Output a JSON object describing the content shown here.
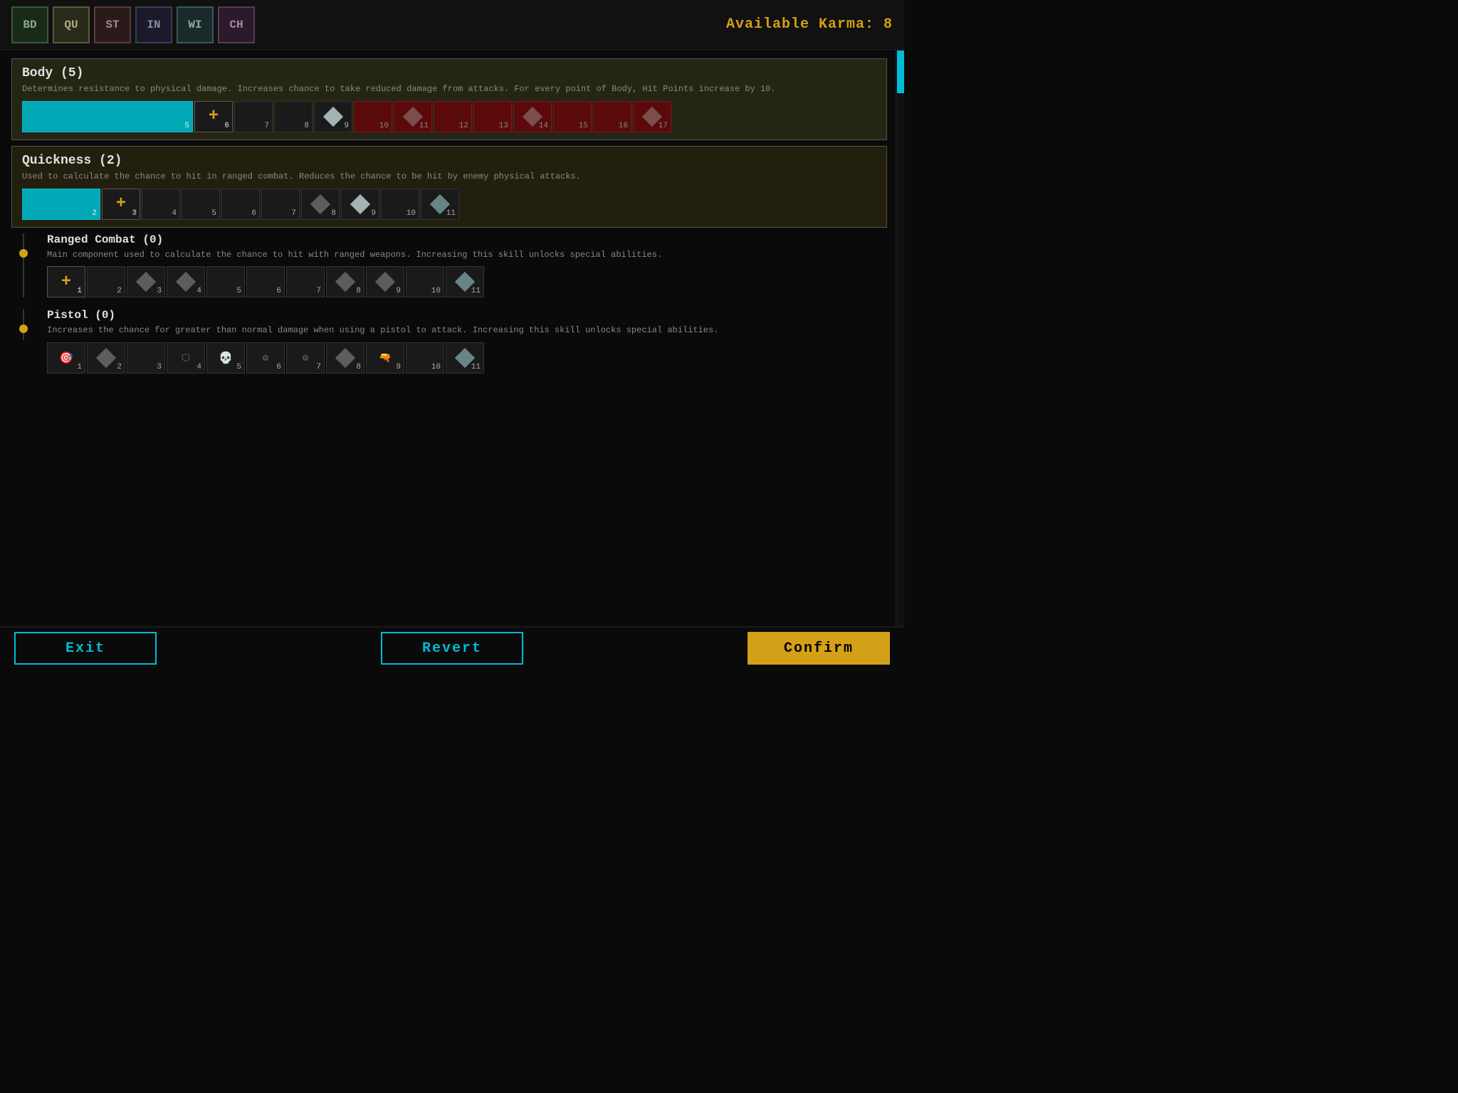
{
  "header": {
    "karma_label": "Available Karma: 8",
    "tabs": [
      {
        "id": "bd",
        "label": "BD",
        "class": "bd"
      },
      {
        "id": "qu",
        "label": "QU",
        "class": "qu"
      },
      {
        "id": "st",
        "label": "ST",
        "class": "st"
      },
      {
        "id": "in",
        "label": "IN",
        "class": "in"
      },
      {
        "id": "wi",
        "label": "WI",
        "class": "wi"
      },
      {
        "id": "ch",
        "label": "CH",
        "class": "ch"
      }
    ]
  },
  "body_stat": {
    "title": "Body (5)",
    "description": "Determines resistance to physical damage. Increases chance to take reduced damage from attacks. For every point of Body, Hit Points increase by 10.",
    "current": 5,
    "max": 17,
    "filled_to": 5,
    "next_value": 6
  },
  "quickness_stat": {
    "title": "Quickness (2)",
    "description": "Used to calculate the chance to hit in ranged combat. Reduces the chance to be hit by enemy physical attacks.",
    "current": 2,
    "max": 11,
    "filled_to": 2,
    "next_value": 3
  },
  "ranged_combat_skill": {
    "title": "Ranged Combat (0)",
    "description": "Main component used to calculate the chance to hit with ranged weapons. Increasing this skill unlocks special abilities.",
    "current": 0,
    "max": 11,
    "filled_to": 0,
    "next_value": 1
  },
  "pistol_skill": {
    "title": "Pistol (0)",
    "description": "Increases the chance for greater than normal damage when using a pistol to attack. Increasing this skill unlocks special abilities.",
    "current": 0,
    "max": 11
  },
  "footer": {
    "exit_label": "Exit",
    "revert_label": "Revert",
    "confirm_label": "Confirm"
  }
}
